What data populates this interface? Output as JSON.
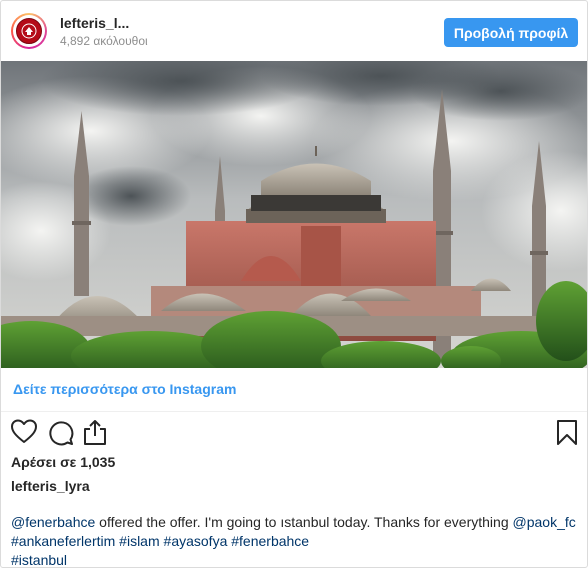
{
  "header": {
    "username": "lefteris_l...",
    "followers": "4,892 ακόλουθοι",
    "view_profile_label": "Προβολή προφίλ"
  },
  "post": {
    "image_alt": "Hagia Sophia",
    "see_more_label": "Δείτε περισσότερα στο Instagram",
    "likes": "Αρέσει σε 1,035",
    "owner": "lefteris_lyra"
  },
  "caption": {
    "mention1": "@fenerbahce",
    "text1": " offered the offer. I'm going to ıstanbul today. Thanks for everything ",
    "mention2": "@paok_fc",
    "hashtag1": "#ankaneferlertim",
    "hashtag2": "#islam",
    "hashtag3": "#ayasofya",
    "hashtag4": "#fenerbahce",
    "hashtag5": "#istanbul"
  },
  "colors": {
    "button": "#3897f0",
    "link": "#3897f0",
    "tag": "#003569"
  },
  "icons": {
    "like": "heart-icon",
    "comment": "comment-icon",
    "share": "share-icon",
    "save": "bookmark-icon"
  }
}
